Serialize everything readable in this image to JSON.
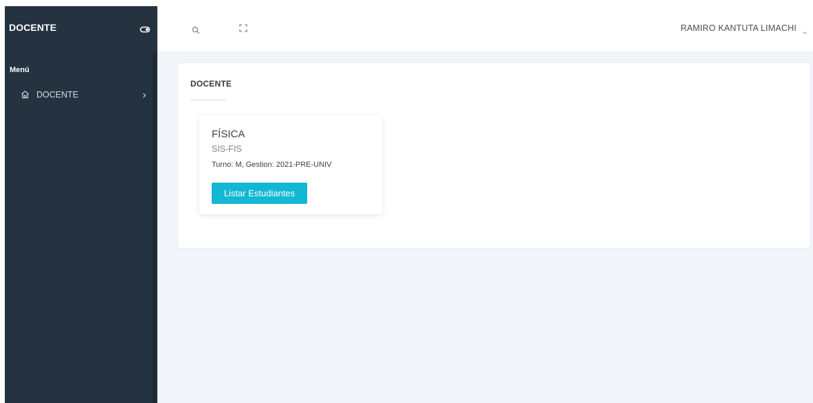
{
  "sidebar": {
    "brand": "DOCENTE",
    "toggle_icon": "toggle-icon",
    "menu_title": "Menú",
    "items": [
      {
        "label": "DOCENTE",
        "icon": "home-icon",
        "chevron": "chevron-right-icon"
      }
    ],
    "background_color": "#253341"
  },
  "topbar": {
    "search_icon": "search-icon",
    "fullscreen_icon": "fullscreen-icon",
    "user_name": "RAMIRO KANTUTA LIMACHI",
    "user_chevron": "chevron-down-icon"
  },
  "main": {
    "panel_title": "DOCENTE",
    "courses": [
      {
        "name": "FÍSICA",
        "code": "SIS-FIS",
        "info": "Turno: M, Gestion: 2021-PRE-UNIV",
        "button_label": "Listar Estudiantes"
      }
    ],
    "accent_color": "#12b7d3",
    "background_color": "#f1f5f9"
  }
}
